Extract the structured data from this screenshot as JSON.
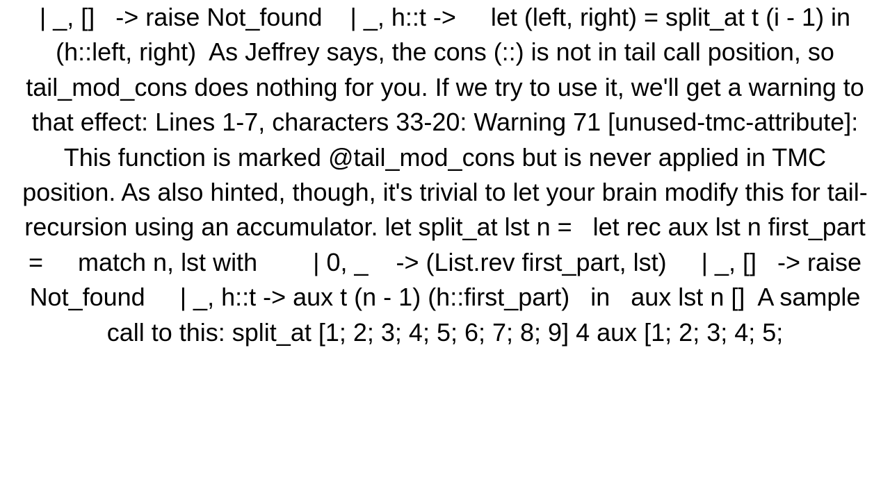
{
  "text": "| _, []   -> raise Not_found    | _, h::t ->     let (left, right) = split_at t (i - 1) in     (h::left, right)  As Jeffrey says, the cons (::) is not in tail call position, so tail_mod_cons does nothing for you. If we try to use it, we'll get a warning to that effect: Lines 1-7, characters 33-20: Warning 71 [unused-tmc-attribute]: This function is marked @tail_mod_cons but is never applied in TMC position. As also hinted, though, it's trivial to let your brain modify this for tail-recursion using an accumulator. let split_at lst n =   let rec aux lst n first_part =     match n, lst with        | 0, _    -> (List.rev first_part, lst)     | _, []   -> raise Not_found     | _, h::t -> aux t (n - 1) (h::first_part)   in   aux lst n []  A sample call to this: split_at [1; 2; 3; 4; 5; 6; 7; 8; 9] 4 aux [1; 2; 3; 4; 5;"
}
